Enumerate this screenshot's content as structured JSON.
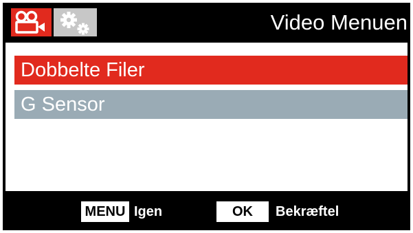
{
  "header": {
    "title": "Video Menuen",
    "tabs": [
      {
        "icon": "video-camera-icon",
        "active": true
      },
      {
        "icon": "settings-gears-icon",
        "active": false
      }
    ]
  },
  "menu": {
    "items": [
      {
        "label": "Dobbelte Filer",
        "selected": true
      },
      {
        "label": "G Sensor",
        "selected": false
      }
    ]
  },
  "footer": {
    "menu_key": "MENU",
    "menu_hint": "Igen",
    "ok_key": "OK",
    "ok_hint": "Bekræftel"
  },
  "colors": {
    "accent": "#e12a1e",
    "inactive_tab": "#c7c7c7",
    "unselected_item": "#9aabb5",
    "background": "#000000"
  }
}
